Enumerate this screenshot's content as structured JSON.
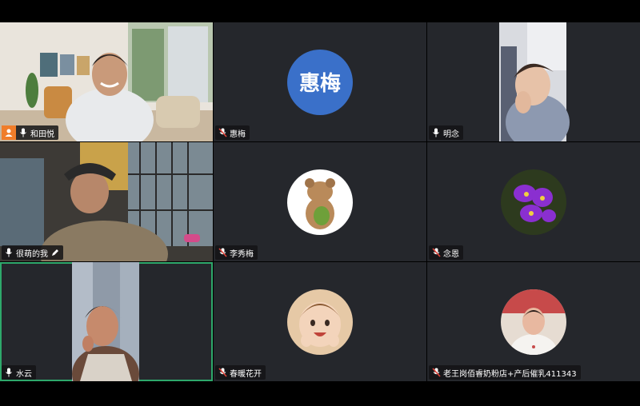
{
  "participants": [
    {
      "name": "和田悦",
      "host": true,
      "video": true
    },
    {
      "name": "惠梅",
      "avatar_text": "惠梅",
      "muted": true
    },
    {
      "name": "明念",
      "video": true
    },
    {
      "name": "很萌的我",
      "video": true,
      "editing": true
    },
    {
      "name": "李秀梅",
      "muted": true
    },
    {
      "name": "念恩",
      "muted": true
    },
    {
      "name": "水云",
      "video": true,
      "active_speaker": true
    },
    {
      "name": "春暖花开",
      "muted": true
    },
    {
      "name": "老王岗佰睿奶粉店+产后催乳411343",
      "muted": true
    }
  ],
  "colors": {
    "tile_bg": "#25272c",
    "active_border": "#2ea86b",
    "host_badge": "#f07d2a",
    "avatar_blue": "#3a70c9",
    "muted_red": "#e0443a"
  }
}
